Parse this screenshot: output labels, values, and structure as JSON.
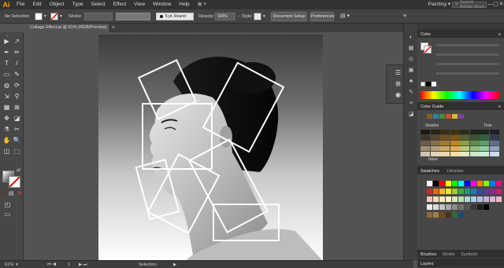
{
  "app": {
    "logo": "Ai",
    "workspace": "Painting ▾",
    "stock_placeholder": "Search Adobe Stock"
  },
  "window_controls": {
    "minimize": "—",
    "maximize": "▢",
    "close": "✕"
  },
  "menu": [
    "File",
    "Edit",
    "Object",
    "Type",
    "Select",
    "Effect",
    "View",
    "Window",
    "Help"
  ],
  "control_bar": {
    "selection_label": "No Selection",
    "stroke_label": "Stroke:",
    "brush_value": "5 pt. Round",
    "opacity_label": "Opacity:",
    "opacity_value": "100%",
    "style_label": "Style:",
    "doc_setup_label": "Document Setup",
    "preferences_label": "Preferences"
  },
  "document_tab": {
    "title": "Collage Effect.ai @ 61% (RGB/Preview)",
    "close": "×"
  },
  "status_bar": {
    "zoom": "61%",
    "artboard_index": "1",
    "tool": "Selection"
  },
  "tools": {
    "row_glyphs": [
      "▶",
      "↗",
      "✒",
      "✏",
      "T",
      "/",
      "▭",
      "✎",
      "◍",
      "⟳",
      "⇲",
      "⚲",
      "▦",
      "⊞",
      "✥",
      "◪",
      "⚗",
      "✂",
      "✋",
      "🔍",
      "◫",
      "⬚"
    ],
    "names": [
      "selection",
      "direct-selection",
      "pen",
      "curvature",
      "type",
      "line",
      "rectangle",
      "paintbrush",
      "blob-brush",
      "rotate",
      "scale",
      "warp",
      "free-transform",
      "shape-builder",
      "perspective",
      "mesh",
      "gradient",
      "eyedropper",
      "blend",
      "scissors",
      "hand",
      "zoom"
    ],
    "swap": "⇄",
    "color_modes": [
      "■",
      "▤",
      "⊘"
    ]
  },
  "panels": {
    "color": {
      "title": "Color",
      "menu": "≡"
    },
    "color_guide": {
      "title": "Color Guide",
      "shades_label": "Shades",
      "tints_label": "Tints",
      "none_label": "None"
    },
    "swatches": {
      "title": "Swatches",
      "tab2": "Libraries"
    },
    "brushes_tabs": [
      "Brushes",
      "Stroke",
      "Symbols"
    ],
    "layers": {
      "title": "Layers"
    }
  },
  "colors": {
    "chrome_dark": "#323232",
    "panel": "#474747",
    "canvas": "#535353",
    "accent_orange": "#ff9a00",
    "frame_white": "#ffffff",
    "harmony": [
      "#8a5a1e",
      "#2f7f9f",
      "#3f8f3f",
      "#d24f1e",
      "#d8b72e",
      "#7f3f9f"
    ],
    "shade_rows": [
      [
        "#1d1a15",
        "#2a2419",
        "#3a2d16",
        "#3f3010",
        "#2c2b1c",
        "#1f2419",
        "#1b261a",
        "#1c1f24"
      ],
      [
        "#3b3429",
        "#55462f",
        "#6b5121",
        "#7a5716",
        "#546030",
        "#38532e",
        "#325f3a",
        "#333c4c"
      ],
      [
        "#6b5d47",
        "#86704d",
        "#a37b2f",
        "#c28421",
        "#8da04a",
        "#5d8d4d",
        "#57a06a",
        "#5a6e90"
      ],
      [
        "#9e8d72",
        "#b59f7d",
        "#cfa862",
        "#e2ad57",
        "#b9cc76",
        "#8fbf7e",
        "#8bcfa0",
        "#8fa4c8"
      ],
      [
        "#cfc3ad",
        "#e0d4bd",
        "#ecd9ad",
        "#f6dcaa",
        "#e1ebbf",
        "#cde7c7",
        "#cbeed8",
        "#cfdaf0"
      ]
    ],
    "swatch_grid": [
      [
        "#ffffff",
        "#000000",
        "#ff0000",
        "#ffff00",
        "#00ff00",
        "#00ffff",
        "#0000ff",
        "#ff00ff",
        "#ff7f00",
        "#7fff00",
        "#007fff",
        "#ff007f"
      ],
      [
        "#c12f28",
        "#e8661b",
        "#f7b81f",
        "#f0e62b",
        "#9ec93a",
        "#3fa447",
        "#22948a",
        "#1f78b6",
        "#2f4fa0",
        "#5b3a98",
        "#8a2b8e",
        "#c2207a"
      ],
      [
        "#f5c7bd",
        "#f9d9b8",
        "#fbe9b6",
        "#f6f1b7",
        "#d8e8b5",
        "#b9ddb6",
        "#addad4",
        "#aecbe8",
        "#b4bcde",
        "#c3b3da",
        "#dcb4d8",
        "#efb6cf"
      ],
      [
        "#ededed",
        "#d9d9d9",
        "#c4c4c4",
        "#a8a8a8",
        "#8c8c8c",
        "#707070",
        "#545454",
        "#383838",
        "#1c1c1c",
        "#000000"
      ],
      [
        "#8c6a3a",
        "#a67c45",
        "#6b4a23",
        "#4a3218",
        "#2e6b3a",
        "#1d4a7a"
      ]
    ]
  }
}
